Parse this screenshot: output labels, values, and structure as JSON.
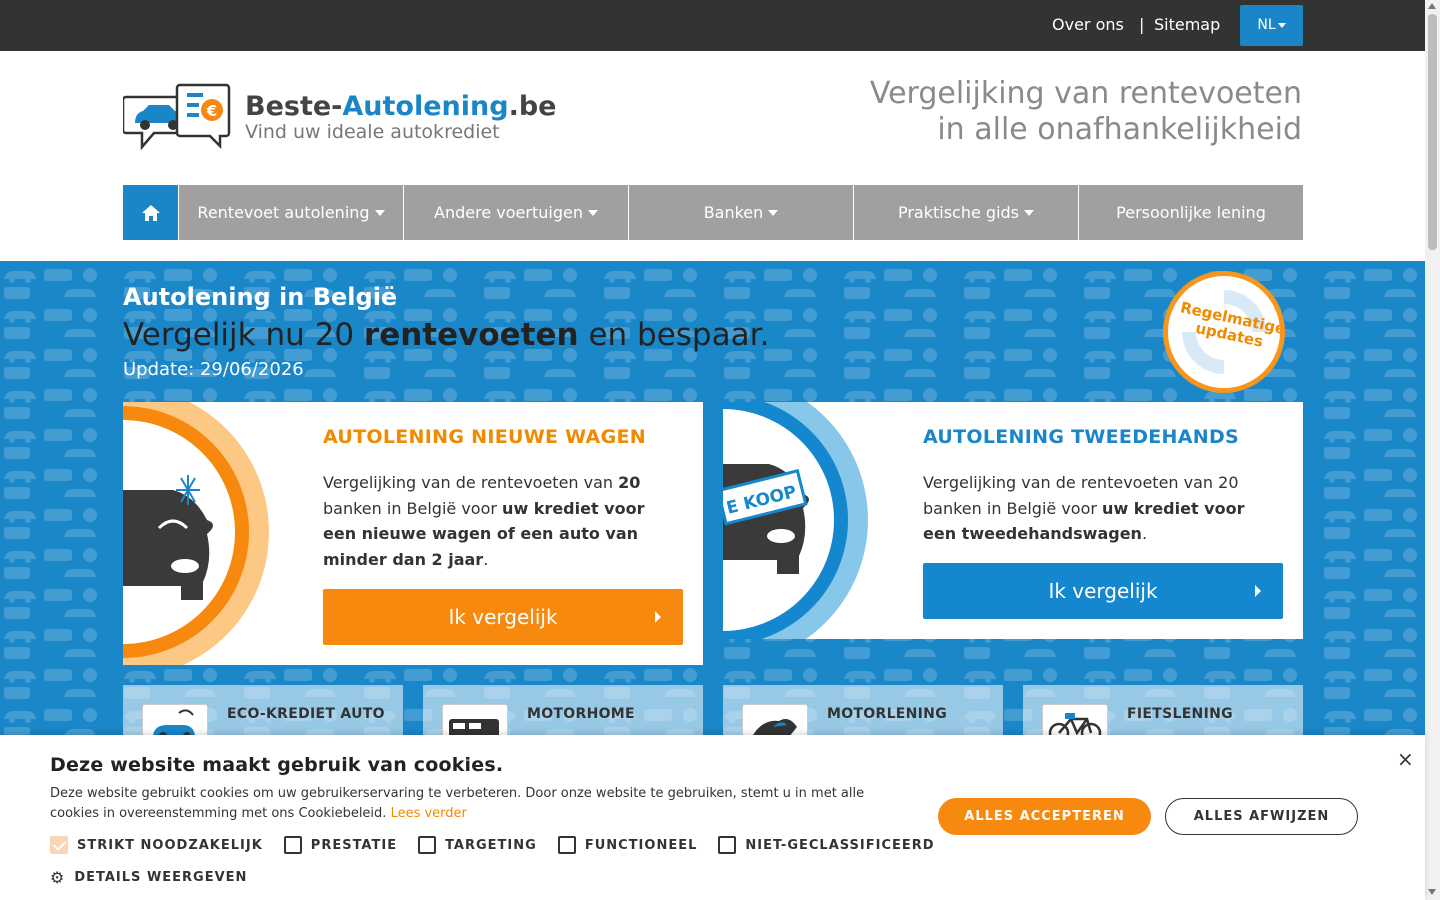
{
  "topbar": {
    "about": "Over ons",
    "separator": "|",
    "sitemap": "Sitemap",
    "language": "NL",
    "bg_color": "#333333"
  },
  "header": {
    "brand_part1": "Beste-",
    "brand_part2": "Autolening",
    "brand_part3": ".be",
    "tagline": "Vind uw ideale autokrediet",
    "slogan_line1": "Vergelijking van rentevoeten",
    "slogan_line2": "in alle onafhankelijkheid"
  },
  "nav": {
    "home_icon": "home-icon",
    "items": [
      {
        "label": "Rentevoet autolening",
        "dropdown": true
      },
      {
        "label": "Andere voertuigen",
        "dropdown": true
      },
      {
        "label": "Banken",
        "dropdown": true
      },
      {
        "label": "Praktische gids",
        "dropdown": true
      },
      {
        "label": "Persoonlijke lening",
        "dropdown": false
      }
    ]
  },
  "hero": {
    "title": "Autolening in België",
    "lead_pre": "Vergelijk nu 20 ",
    "lead_bold": "rentevoeten",
    "lead_post": " en bespaar.",
    "update": "Update: 29/06/2026",
    "badge_line1": "Regelmatige",
    "badge_line2": "updates",
    "bg_color": "#1a87c9"
  },
  "cards": {
    "new": {
      "title": "AUTOLENING NIEUWE WAGEN",
      "desc_1": "Vergelijking van de rentevoeten van ",
      "desc_2": "20",
      "desc_3": " banken in België voor ",
      "desc_4": "uw krediet voor een nieuwe wagen of een auto van minder dan 2 jaar",
      "desc_5": ".",
      "button": "Ik vergelijk",
      "accent": "#f7890f"
    },
    "used": {
      "title": "AUTOLENING TWEEDEHANDS",
      "desc_1": "Vergelijking van de rentevoeten van 20 banken in België voor ",
      "desc_2": "uw krediet voor een tweedehandswagen",
      "desc_3": ".",
      "button": "Ik vergelijk",
      "sign": "E KOOP",
      "accent": "#1587cf"
    }
  },
  "tiles": [
    {
      "label": "ECO-KREDIET AUTO",
      "icon": "eco-car-icon"
    },
    {
      "label": "MOTORHOME",
      "icon": "motorhome-icon"
    },
    {
      "label": "MOTORLENING",
      "icon": "motorcycle-icon"
    },
    {
      "label": "FIETSLENING",
      "icon": "bicycle-icon"
    }
  ],
  "cookie": {
    "title": "Deze website maakt gebruik van cookies.",
    "text": "Deze website gebruikt cookies om uw gebruikerservaring te verbeteren. Door onze website te gebruiken, stemt u in met alle cookies in overeenstemming met ons Cookiebeleid.",
    "link": "Lees verder",
    "checks": [
      {
        "label": "STRIKT NOODZAKELIJK",
        "checked": true
      },
      {
        "label": "PRESTATIE",
        "checked": false
      },
      {
        "label": "TARGETING",
        "checked": false
      },
      {
        "label": "FUNCTIONEEL",
        "checked": false
      },
      {
        "label": "NIET-GECLASSIFICEERD",
        "checked": false
      }
    ],
    "details": "DETAILS WEERGEVEN",
    "accept": "ALLES ACCEPTEREN",
    "reject": "ALLES AFWIJZEN",
    "close": "×"
  }
}
